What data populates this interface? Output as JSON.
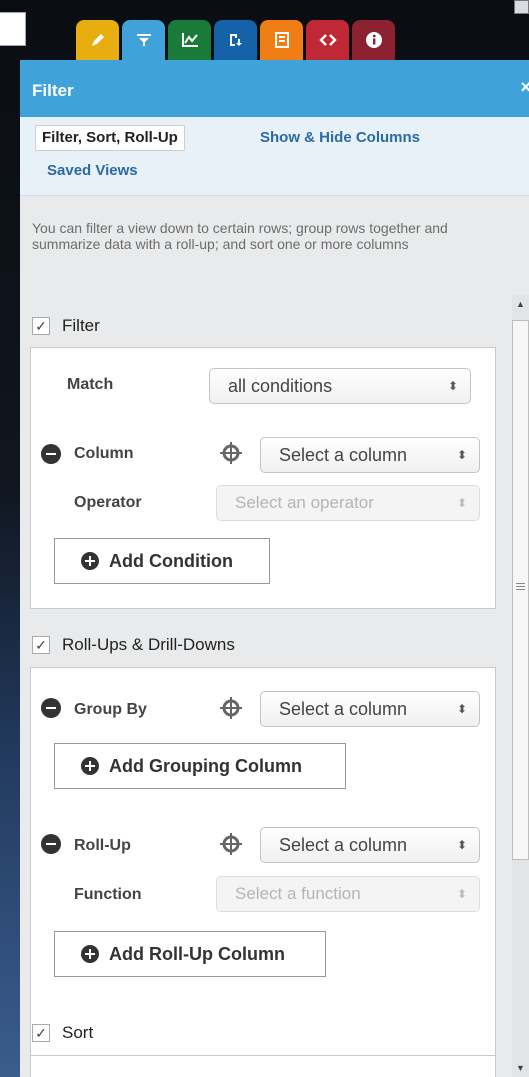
{
  "tabs": [
    {
      "name": "edit",
      "color": "#e8ad0e",
      "icon": "pencil-icon"
    },
    {
      "name": "filter",
      "color": "#3fa2d8",
      "icon": "funnel-icon"
    },
    {
      "name": "chart",
      "color": "#1a7a3a",
      "icon": "chart-icon"
    },
    {
      "name": "export",
      "color": "#1562a8",
      "icon": "download-icon"
    },
    {
      "name": "report",
      "color": "#ef7e16",
      "icon": "document-icon"
    },
    {
      "name": "code",
      "color": "#c02835",
      "icon": "code-icon"
    },
    {
      "name": "info",
      "color": "#8c2231",
      "icon": "info-icon"
    }
  ],
  "header": {
    "title": "Filter",
    "close": "×"
  },
  "subnav": {
    "active": "Filter, Sort, Roll-Up",
    "show_hide": "Show & Hide Columns",
    "saved_views": "Saved Views"
  },
  "description": "You can filter a view down to certain rows; group rows together and summarize data with a roll-up; and sort one or more columns",
  "filter": {
    "title": "Filter",
    "checked": "✓",
    "match_label": "Match",
    "match_value": "all conditions",
    "column_label": "Column",
    "column_placeholder": "Select a column",
    "operator_label": "Operator",
    "operator_placeholder": "Select an operator",
    "add_button": "Add Condition"
  },
  "rollups": {
    "title": "Roll-Ups & Drill-Downs",
    "checked": "✓",
    "group_label": "Group By",
    "group_placeholder": "Select a column",
    "add_group_button": "Add Grouping Column",
    "rollup_label": "Roll-Up",
    "rollup_placeholder": "Select a column",
    "function_label": "Function",
    "function_placeholder": "Select a function",
    "add_rollup_button": "Add Roll-Up Column"
  },
  "sort": {
    "title": "Sort",
    "checked": "✓"
  },
  "updown": "⬍"
}
